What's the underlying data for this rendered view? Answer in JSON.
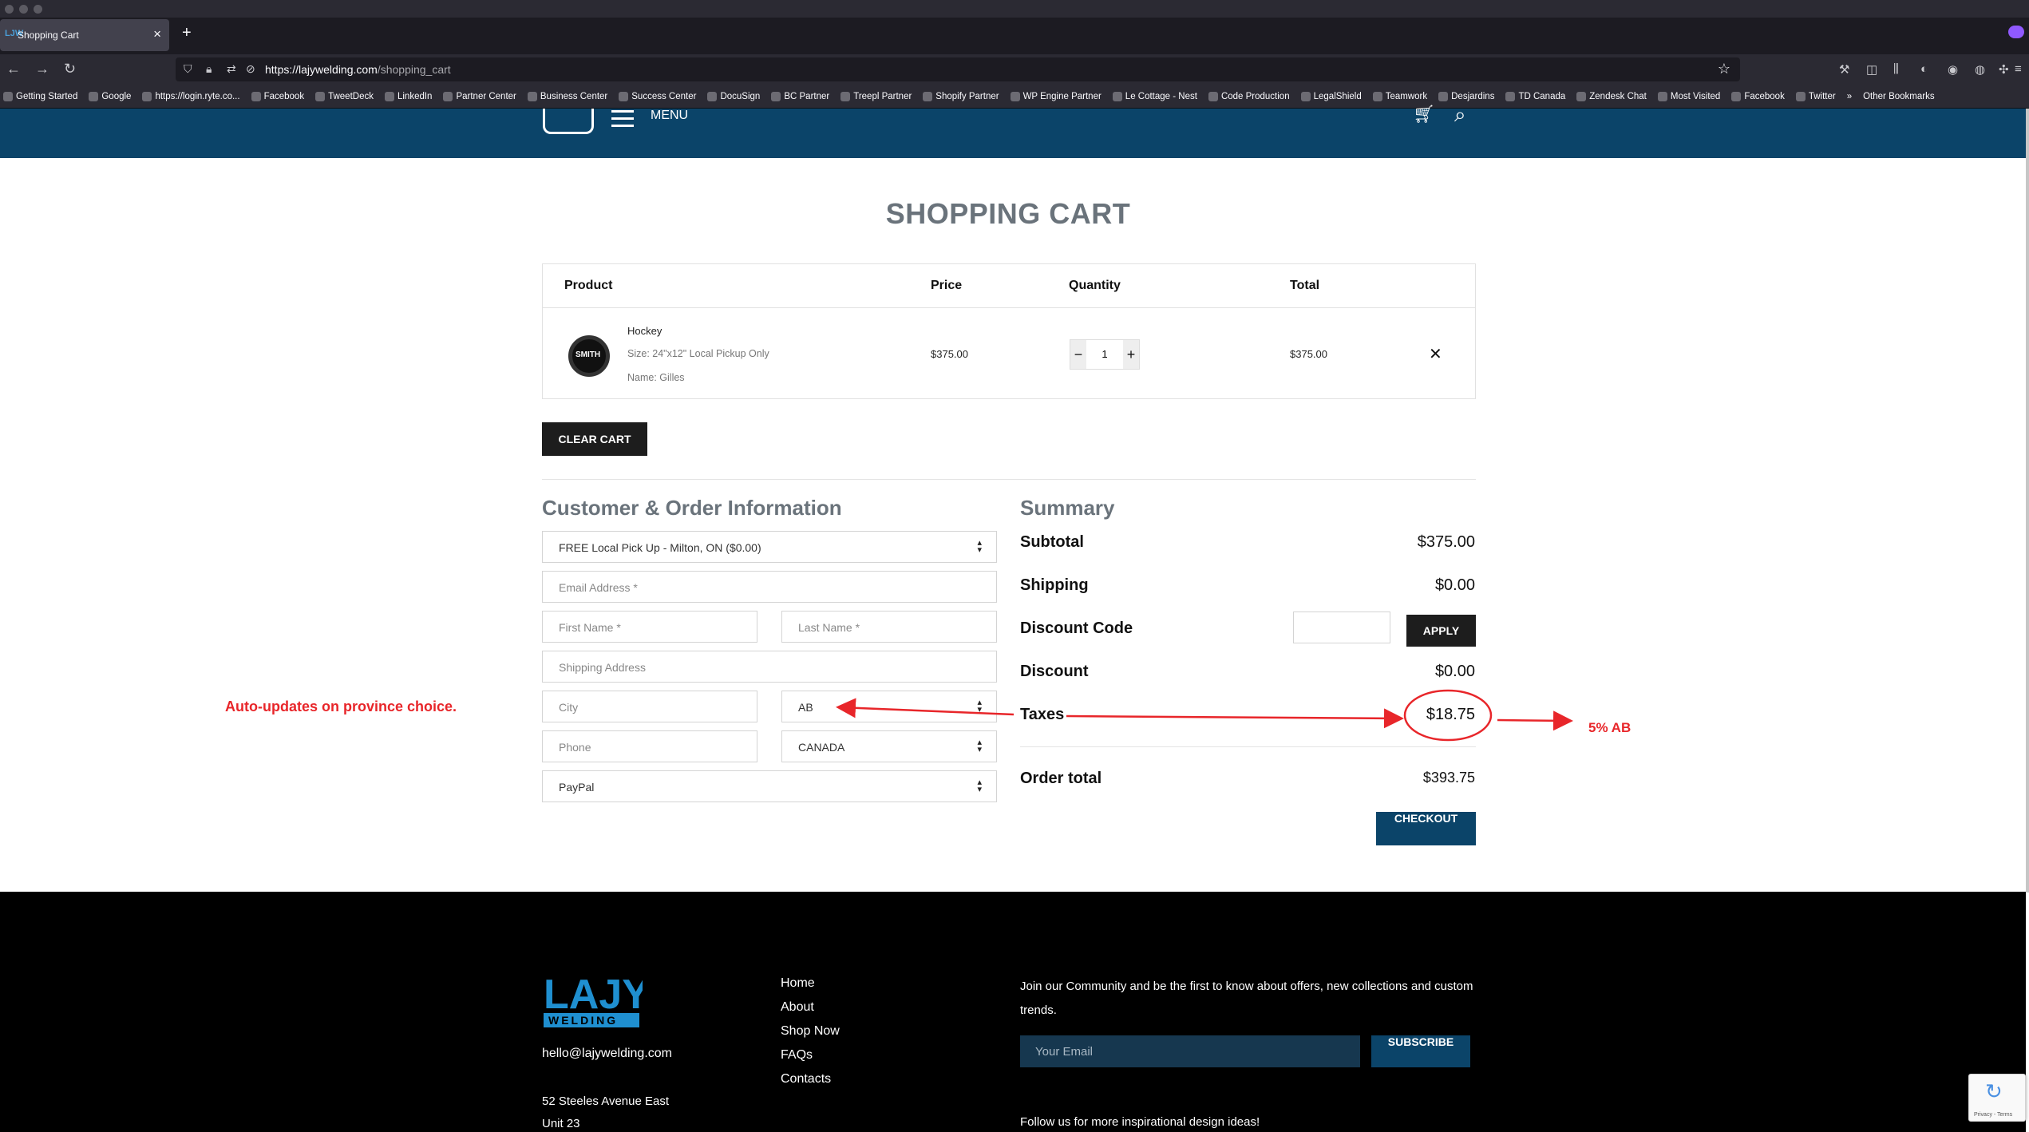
{
  "browser": {
    "tab_title": "Shopping Cart",
    "tab_favicon": "LJW",
    "new_tab": "+",
    "close_tab": "×",
    "url_host": "https://lajywelding.com",
    "url_path": "/shopping_cart",
    "bookmarks": [
      "Getting Started",
      "Google",
      "https://login.ryte.co...",
      "Facebook",
      "TweetDeck",
      "LinkedIn",
      "Partner Center",
      "Business Center",
      "Success Center",
      "DocuSign",
      "BC Partner",
      "Treepl Partner",
      "Shopify Partner",
      "WP Engine Partner",
      "Le Cottage - Nest",
      "Code Production",
      "LegalShield",
      "Teamwork",
      "Desjardins",
      "TD Canada",
      "Zendesk Chat",
      "Most Visited",
      "Facebook",
      "Twitter"
    ],
    "bookmarks_overflow": "»",
    "other_bookmarks": "Other Bookmarks"
  },
  "site": {
    "menu_label": "MENU",
    "page_title": "SHOPPING CART"
  },
  "cart": {
    "headers": {
      "product": "Product",
      "price": "Price",
      "quantity": "Quantity",
      "total": "Total"
    },
    "item": {
      "name": "Hockey",
      "size": "Size: 24\"x12\" Local Pickup Only",
      "custom_name": "Name: Gilles",
      "price": "$375.00",
      "quantity": "1",
      "total": "$375.00"
    },
    "clear_label": "CLEAR CART"
  },
  "customer": {
    "title": "Customer & Order Information",
    "shipping_method": "FREE Local Pick Up - Milton, ON ($0.00)",
    "email_placeholder": "Email Address *",
    "first_name_placeholder": "First Name *",
    "last_name_placeholder": "Last Name *",
    "address_placeholder": "Shipping Address",
    "city_placeholder": "City",
    "province": "AB",
    "phone_placeholder": "Phone",
    "country": "CANADA",
    "payment": "PayPal"
  },
  "summary": {
    "title": "Summary",
    "subtotal_label": "Subtotal",
    "subtotal": "$375.00",
    "shipping_label": "Shipping",
    "shipping": "$0.00",
    "discount_code_label": "Discount Code",
    "apply_label": "APPLY",
    "discount_label": "Discount",
    "discount": "$0.00",
    "taxes_label": "Taxes",
    "taxes": "$18.75",
    "order_total_label": "Order total",
    "order_total": "$393.75",
    "checkout_label": "CHECKOUT"
  },
  "annotations": {
    "left": "Auto-updates on province choice.",
    "right": "5% AB",
    "color": "#e8262a"
  },
  "footer": {
    "logo_top": "LAJY",
    "logo_bottom": "WELDING",
    "email": "hello@lajywelding.com",
    "address_line1": "52 Steeles Avenue East",
    "address_line2": "Unit 23",
    "links": [
      "Home",
      "About",
      "Shop Now",
      "FAQs",
      "Contacts"
    ],
    "newsletter_text": "Join our Community and be the first to know about offers, new collections and custom trends.",
    "email_placeholder": "Your Email",
    "subscribe_label": "SUBSCRIBE",
    "follow_text": "Follow us for more inspirational design ideas!",
    "recaptcha_text": "Privacy - Terms"
  },
  "colors": {
    "brand_blue": "#0b4469",
    "dark_button": "#1d1d1d",
    "annotation_red": "#e8262a"
  }
}
